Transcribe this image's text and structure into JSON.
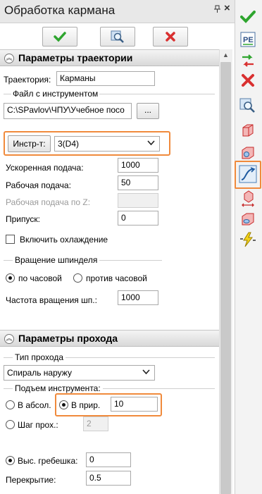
{
  "window": {
    "title": "Обработка кармана"
  },
  "top_buttons": [
    {
      "name": "ok",
      "icon": "check-icon"
    },
    {
      "name": "preview",
      "icon": "magnifier-icon"
    },
    {
      "name": "cancel",
      "icon": "cross-icon"
    }
  ],
  "trajectory_section": {
    "title": "Параметры траектории",
    "trajectory_label": "Траектория:",
    "trajectory_value": "Карманы",
    "tool_file_group": "Файл с инструментом",
    "tool_file_path": "C:\\SPavlov\\ЧПУ\\Учебное посо",
    "browse_label": "...",
    "tool_button": "Инстр-т:",
    "tool_value": "3(D4)",
    "rapid_feed_label": "Ускоренная подача:",
    "rapid_feed_value": "1000",
    "work_feed_label": "Рабочая подача:",
    "work_feed_value": "50",
    "z_feed_label": "Рабочая подача по Z:",
    "z_feed_value": "",
    "allowance_label": "Припуск:",
    "allowance_value": "0",
    "cooling_label": "Включить охлаждение",
    "spindle_group": "Вращение шпинделя",
    "cw_label": "по часовой",
    "ccw_label": "против часовой",
    "spindle_speed_label": "Частота вращения шп.:",
    "spindle_speed_value": "1000"
  },
  "pass_section": {
    "title": "Параметры прохода",
    "pass_type_group": "Тип прохода",
    "pass_type_value": "Спираль наружу",
    "lift_group": "Подъем инструмента:",
    "abs_label": "В абсол.",
    "rel_label": "В прир.",
    "rel_value": "10",
    "step_label": "Шаг прох.:",
    "step_value": "2",
    "scallop_label": "Выс. гребешка:",
    "scallop_value": "0",
    "overlap_label": "Перекрытие:",
    "overlap_value": "0.5"
  },
  "right_toolbar": [
    "checkmark-icon",
    "pe-icon",
    "sort-arrows-icon",
    "cancel-x-icon",
    "magnifier-icon",
    "red-cube-icon",
    "cube-tool-icon",
    "path-curve-icon",
    "cube-arrow-icon",
    "cube-bottom-icon",
    "lightning-icon"
  ],
  "colors": {
    "highlight": "#f08a3c",
    "accent_green": "#2fa52f",
    "accent_red": "#d93030"
  }
}
